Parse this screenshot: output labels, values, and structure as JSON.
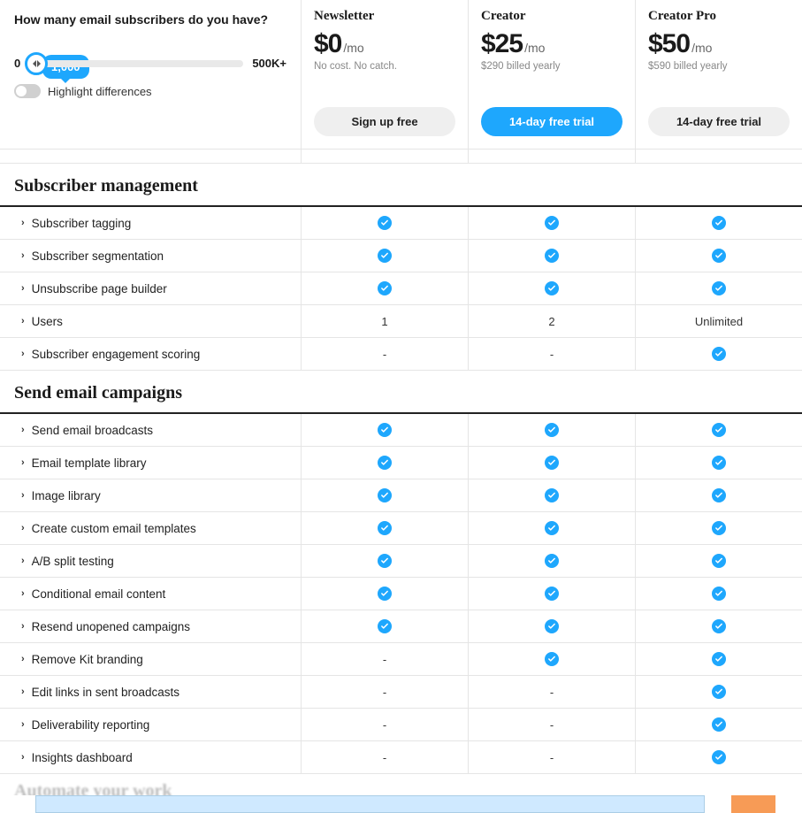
{
  "header": {
    "question": "How many email subscribers do you have?",
    "slider": {
      "value": "1,000",
      "min": "0",
      "max": "500K+"
    },
    "toggle_label": "Highlight differences"
  },
  "plans": [
    {
      "name": "Newsletter",
      "price": "$0",
      "per": "/mo",
      "sub": "No cost. No catch.",
      "cta": "Sign up free",
      "cta_style": "gray"
    },
    {
      "name": "Creator",
      "price": "$25",
      "per": "/mo",
      "sub": "$290 billed yearly",
      "cta": "14-day free trial",
      "cta_style": "blue"
    },
    {
      "name": "Creator Pro",
      "price": "$50",
      "per": "/mo",
      "sub": "$590 billed yearly",
      "cta": "14-day free trial",
      "cta_style": "gray"
    }
  ],
  "sections": [
    {
      "title": "Subscriber management",
      "features": [
        {
          "name": "Subscriber tagging",
          "vals": [
            "check",
            "check",
            "check"
          ]
        },
        {
          "name": "Subscriber segmentation",
          "vals": [
            "check",
            "check",
            "check"
          ]
        },
        {
          "name": "Unsubscribe page builder",
          "vals": [
            "check",
            "check",
            "check"
          ]
        },
        {
          "name": "Users",
          "vals": [
            "1",
            "2",
            "Unlimited"
          ]
        },
        {
          "name": "Subscriber engagement scoring",
          "vals": [
            "-",
            "-",
            "check"
          ]
        }
      ]
    },
    {
      "title": "Send email campaigns",
      "features": [
        {
          "name": "Send email broadcasts",
          "vals": [
            "check",
            "check",
            "check"
          ]
        },
        {
          "name": "Email template library",
          "vals": [
            "check",
            "check",
            "check"
          ]
        },
        {
          "name": "Image library",
          "vals": [
            "check",
            "check",
            "check"
          ]
        },
        {
          "name": "Create custom email templates",
          "vals": [
            "check",
            "check",
            "check"
          ]
        },
        {
          "name": "A/B split testing",
          "vals": [
            "check",
            "check",
            "check"
          ]
        },
        {
          "name": "Conditional email content",
          "vals": [
            "check",
            "check",
            "check"
          ]
        },
        {
          "name": "Resend unopened campaigns",
          "vals": [
            "check",
            "check",
            "check"
          ]
        },
        {
          "name": "Remove Kit branding",
          "vals": [
            "-",
            "check",
            "check"
          ]
        },
        {
          "name": "Edit links in sent broadcasts",
          "vals": [
            "-",
            "-",
            "check"
          ]
        },
        {
          "name": "Deliverability reporting",
          "vals": [
            "-",
            "-",
            "check"
          ]
        },
        {
          "name": "Insights dashboard",
          "vals": [
            "-",
            "-",
            "check"
          ]
        }
      ]
    }
  ]
}
